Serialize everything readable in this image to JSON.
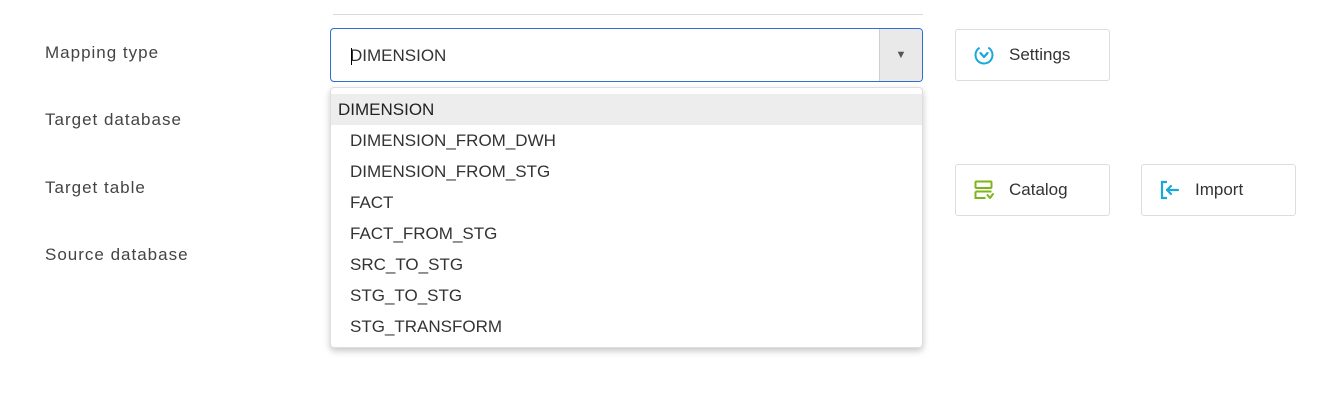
{
  "form": {
    "labels": {
      "mapping_type": "Mapping type",
      "target_database": "Target database",
      "target_table": "Target table",
      "source_database": "Source database"
    },
    "mapping_type": {
      "value": "DIMENSION",
      "toggle_glyph": "▼",
      "options": [
        "DIMENSION",
        "DIMENSION_FROM_DWH",
        "DIMENSION_FROM_STG",
        "FACT",
        "FACT_FROM_STG",
        "SRC_TO_STG",
        "STG_TO_STG",
        "STG_TRANSFORM"
      ],
      "selected_index": 0
    }
  },
  "buttons": {
    "settings": {
      "label": "Settings",
      "icon": "refresh-circle-icon"
    },
    "catalog": {
      "label": "Catalog",
      "icon": "catalog-icon"
    },
    "import": {
      "label": "Import",
      "icon": "import-icon"
    }
  },
  "colors": {
    "focus_border": "#2f6fd0",
    "settings_icon": "#1aa7d9",
    "catalog_icon": "#7cb518",
    "import_icon": "#1aa7d9",
    "selected_option_bg": "#ededed"
  }
}
